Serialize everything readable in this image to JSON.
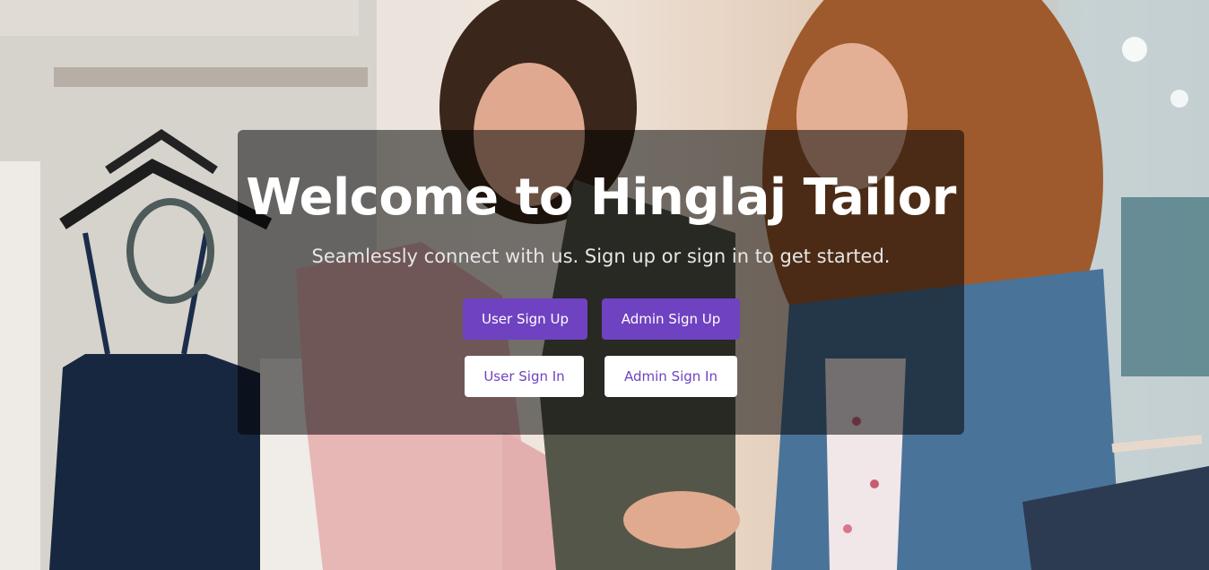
{
  "hero": {
    "title": "Welcome to Hinglaj Tailor",
    "subtitle": "Seamlessly connect with us. Sign up or sign in to get started.",
    "background_description_icon": "boutique-photo"
  },
  "buttons": {
    "user_sign_up": "User Sign Up",
    "admin_sign_up": "Admin Sign Up",
    "user_sign_in": "User Sign In",
    "admin_sign_in": "Admin Sign In"
  },
  "colors": {
    "accent": "#6f42c1",
    "overlay": "rgba(0,0,0,0.52)",
    "text_light": "#ffffff"
  }
}
